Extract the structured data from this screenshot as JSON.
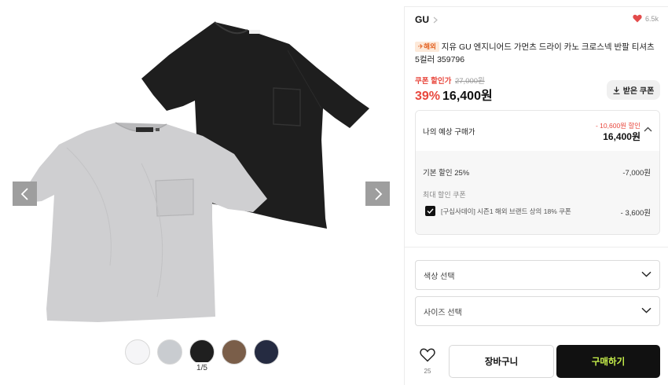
{
  "gallery": {
    "page_indicator": "1/5",
    "swatches": [
      {
        "name": "white",
        "color": "#f5f5f7"
      },
      {
        "name": "light-gray",
        "color": "#c9ccd0"
      },
      {
        "name": "black",
        "color": "#1f1f1f"
      },
      {
        "name": "brown",
        "color": "#7a5e49"
      },
      {
        "name": "navy",
        "color": "#252b41"
      }
    ],
    "icons": {
      "prev": "chevron-left-icon",
      "next": "chevron-right-icon"
    }
  },
  "product": {
    "brand": "GU",
    "like_count": "6.5k",
    "overseas_badge": "✈해외",
    "title": "지유 GU 엔지니어드 가먼츠 드라이 카노 크로스넥 반팔 티셔츠 5컬러 359796",
    "coupon_label": "쿠폰 할인가",
    "original_price": "27,000원",
    "discount_rate": "39%",
    "final_price": "16,400원",
    "coupon_button": "받은 쿠폰"
  },
  "estimate": {
    "label": "나의 예상 구매가",
    "saving": "- 10,600원 할인",
    "price": "16,400원",
    "base_discount_label": "기본 할인 25%",
    "base_discount_value": "-7,000원",
    "max_coupon_label": "최대 할인 쿠폰",
    "coupon_desc": "[구십사데이] 시즌1 해외 브랜드 상의 18% 쿠폰",
    "coupon_amount": "- 3,600원"
  },
  "options": {
    "color_placeholder": "색상 선택",
    "size_placeholder": "사이즈 선택"
  },
  "actions": {
    "wish_count": "25",
    "cart_label": "장바구니",
    "buy_label": "구매하기"
  },
  "colors": {
    "accent_red": "#e8473d",
    "buy_text": "#c8f14b",
    "heart": "#e34b4b"
  }
}
